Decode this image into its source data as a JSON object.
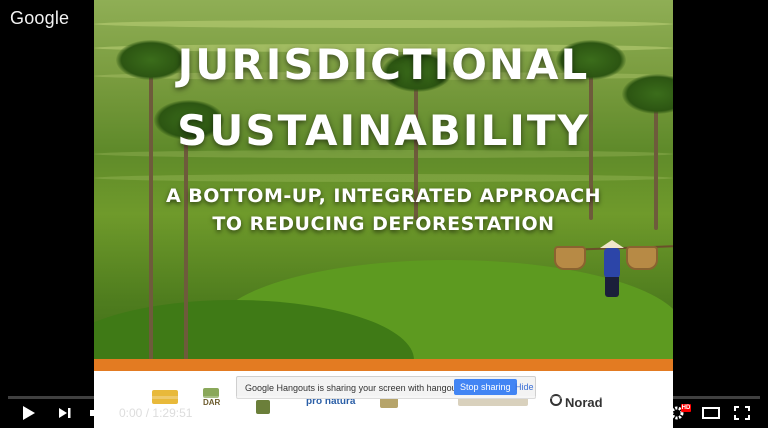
{
  "watermark": "Google",
  "slide": {
    "title_line1": "JURISDICTIONAL",
    "title_line2": "SUSTAINABILITY",
    "subtitle_line1": "A BOTTOM-UP, INTEGRATED APPROACH",
    "subtitle_line2": "TO REDUCING DEFORESTATION"
  },
  "footer": {
    "logos": [
      "DAR",
      "pro natura",
      "Norad"
    ]
  },
  "notification": {
    "message": "Google Hangouts is sharing your screen with hangouts.google.com.",
    "stop_label": "Stop sharing",
    "hide_label": "Hide"
  },
  "player": {
    "current_time": "0:00",
    "separator": "/",
    "duration": "1:29:51",
    "progress_fraction": 0.0,
    "hd_label": "HD",
    "accent": "#ff0000"
  }
}
